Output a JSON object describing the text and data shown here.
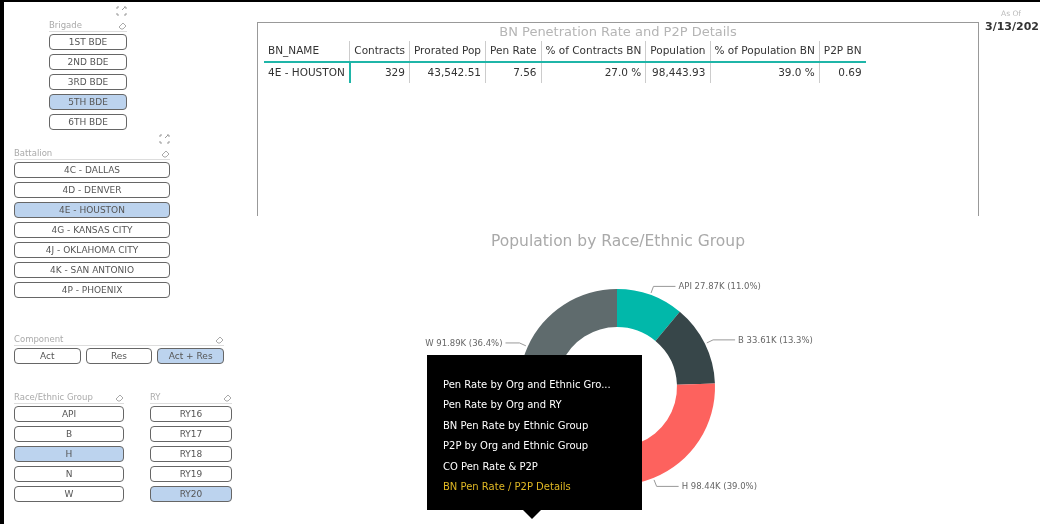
{
  "brigade_slicer": {
    "title": "Brigade",
    "focus_icon": true,
    "items": [
      {
        "label": "1ST BDE",
        "selected": false
      },
      {
        "label": "2ND BDE",
        "selected": false
      },
      {
        "label": "3RD BDE",
        "selected": false
      },
      {
        "label": "5TH BDE",
        "selected": true
      },
      {
        "label": "6TH BDE",
        "selected": false
      }
    ]
  },
  "battalion_slicer": {
    "title": "Battalion",
    "focus_icon": true,
    "items": [
      {
        "label": "4C - DALLAS",
        "selected": false
      },
      {
        "label": "4D - DENVER",
        "selected": false
      },
      {
        "label": "4E - HOUSTON",
        "selected": true
      },
      {
        "label": "4G - KANSAS CITY",
        "selected": false
      },
      {
        "label": "4J - OKLAHOMA CITY",
        "selected": false
      },
      {
        "label": "4K - SAN ANTONIO",
        "selected": false
      },
      {
        "label": "4P - PHOENIX",
        "selected": false
      }
    ]
  },
  "component_slicer": {
    "title": "Component",
    "focus_icon": false,
    "items": [
      {
        "label": "Act",
        "selected": false
      },
      {
        "label": "Res",
        "selected": false
      },
      {
        "label": "Act + Res",
        "selected": true
      }
    ]
  },
  "race_slicer": {
    "title": "Race/Ethnic Group",
    "focus_icon": false,
    "items": [
      {
        "label": "API",
        "selected": false
      },
      {
        "label": "B",
        "selected": false
      },
      {
        "label": "H",
        "selected": true
      },
      {
        "label": "N",
        "selected": false
      },
      {
        "label": "W",
        "selected": false
      }
    ]
  },
  "ry_slicer": {
    "title": "RY",
    "focus_icon": false,
    "items": [
      {
        "label": "RY16",
        "selected": false
      },
      {
        "label": "RY17",
        "selected": false
      },
      {
        "label": "RY18",
        "selected": false
      },
      {
        "label": "RY19",
        "selected": false
      },
      {
        "label": "RY20",
        "selected": true
      }
    ]
  },
  "table": {
    "title": "BN Penetration Rate and P2P Details",
    "columns": [
      "BN_NAME",
      "Contracts",
      "Prorated Pop",
      "Pen Rate",
      "% of Contracts BN",
      "Population",
      "% of Population BN",
      "P2P BN"
    ],
    "rows": [
      [
        "4E - HOUSTON",
        "329",
        "43,542.51",
        "7.56",
        "27.0 %",
        "98,443.93",
        "39.0 %",
        "0.69"
      ]
    ]
  },
  "as_of": {
    "label": "As Of",
    "value": "3/13/202"
  },
  "donut": {
    "chart_data": {
      "type": "donut",
      "title": "Population by Race/Ethnic Group",
      "categories": [
        "API",
        "B",
        "H",
        "W"
      ],
      "values": [
        27870,
        33610,
        98440,
        91890
      ],
      "value_labels": [
        "27.87K (11.0%)",
        "33.61K (13.3%)",
        "98.44K (39.0%)",
        "91.89K (36.4%)"
      ]
    }
  },
  "context_menu": {
    "items": [
      {
        "label": "Pen Rate by Org and Ethnic Gro...",
        "selected": false
      },
      {
        "label": "Pen Rate by Org and RY",
        "selected": false
      },
      {
        "label": "BN Pen Rate by Ethnic Group",
        "selected": false
      },
      {
        "label": "P2P by Org and Ethnic Group",
        "selected": false
      },
      {
        "label": "CO Pen Rate & P2P",
        "selected": false
      },
      {
        "label": "BN Pen Rate / P2P Details",
        "selected": true
      }
    ]
  }
}
